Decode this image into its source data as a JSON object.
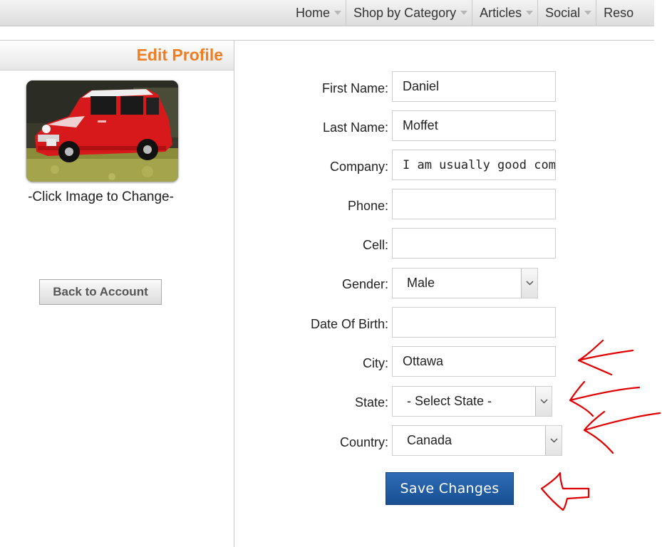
{
  "nav": {
    "items": [
      {
        "label": "Home"
      },
      {
        "label": "Shop by Category"
      },
      {
        "label": "Articles"
      },
      {
        "label": "Social"
      },
      {
        "label": "Reso"
      }
    ]
  },
  "left": {
    "title": "Edit Profile",
    "photo_caption": "-Click Image to Change-",
    "back_label": "Back to Account"
  },
  "form": {
    "first_name": {
      "label": "First Name:",
      "value": "Daniel"
    },
    "last_name": {
      "label": "Last Name:",
      "value": "Moffet"
    },
    "company": {
      "label": "Company:",
      "value": "I am usually good compa"
    },
    "phone": {
      "label": "Phone:",
      "value": ""
    },
    "cell": {
      "label": "Cell:",
      "value": ""
    },
    "gender": {
      "label": "Gender:",
      "value": "Male"
    },
    "dob": {
      "label": "Date Of Birth:",
      "value": ""
    },
    "city": {
      "label": "City:",
      "value": "Ottawa"
    },
    "state": {
      "label": "State:",
      "value": "- Select State -"
    },
    "country": {
      "label": "Country:",
      "value": "Canada"
    },
    "save_label": "Save Changes"
  },
  "colors": {
    "accent": "#ef7d22",
    "button_blue": "#1f5ea8",
    "annotation_red": "#e00000"
  },
  "icons": {
    "dropdown": "chevron-down-icon",
    "nav_caret": "caret-down-icon"
  }
}
